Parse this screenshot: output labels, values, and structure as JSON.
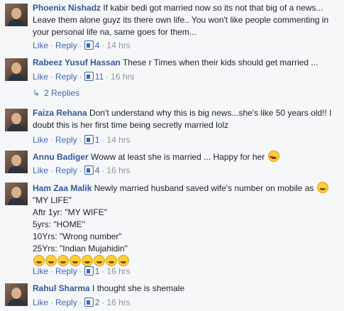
{
  "comments": [
    {
      "name": "Phoenix Nishadz",
      "text": "If kabir bedi got married now so its not that big of a news... Leave them alone guyz its there own life.. You won't like people commenting in your personal life na, same goes for them...",
      "like": "Like",
      "reply": "Reply",
      "likes": "4",
      "time": "14 hrs"
    },
    {
      "name": "Rabeez Yusuf Hassan",
      "text": "These r Times when their kids should get married ...",
      "like": "Like",
      "reply": "Reply",
      "likes": "11",
      "time": "16 hrs",
      "replies": "2 Replies"
    },
    {
      "name": "Faiza Rehana",
      "text": "Don't understand why this is big news...she's like 50 years old!! I doubt this is her first time being secretly married lolz",
      "like": "Like",
      "reply": "Reply",
      "likes": "1",
      "time": "14 hrs"
    },
    {
      "name": "Annu Badiger",
      "text": "Woww at least she is married ... Happy for her",
      "like": "Like",
      "reply": "Reply",
      "likes": "4",
      "time": "16 hrs",
      "emoji": "heart-eyes-emoji"
    },
    {
      "name": "Ham Zaa Malik",
      "text": "Newly married husband saved wife's number on mobile as",
      "lines": [
        "\"MY LIFE\"",
        "Aftr 1yr: \"MY WIFE\"",
        "5yrs: \"HOME\"",
        "10Yrs: \"Wrong number\"",
        "25Yrs: \"Indian Mujahidin\""
      ],
      "emoji_row_count": 8,
      "like": "Like",
      "reply": "Reply",
      "likes": "1",
      "time": "16 hrs"
    },
    {
      "name": "Rahul Sharma",
      "text": "I thought she is shemale",
      "like": "Like",
      "reply": "Reply",
      "likes": "2",
      "time": "16 hrs"
    }
  ],
  "colors": {
    "name": "#365899",
    "link": "#4267b2",
    "meta": "#90949c",
    "background": "#f6f7f9"
  }
}
